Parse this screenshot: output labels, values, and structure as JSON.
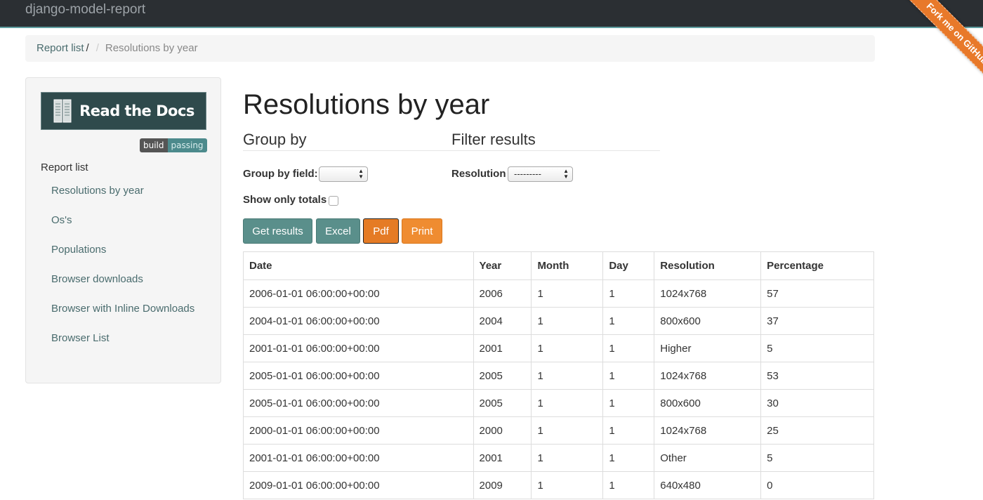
{
  "navbar": {
    "brand": "django-model-report"
  },
  "ribbon": {
    "label": "Fork me on GitHub"
  },
  "breadcrumb": {
    "items": [
      "Report list",
      "Resolutions by year"
    ],
    "slash": "/",
    "divider": "/"
  },
  "sidebar": {
    "rtd_label": "Read the Docs",
    "badge": {
      "left": "build",
      "right": "passing"
    },
    "header": "Report list",
    "items": [
      "Resolutions by year",
      "Os's",
      "Populations",
      "Browser downloads",
      "Browser with Inline Downloads",
      "Browser List"
    ]
  },
  "main": {
    "title": "Resolutions by year",
    "group_by_heading": "Group by",
    "filter_heading": "Filter results",
    "group_by_field_label": "Group by field:",
    "group_by_field_value": "",
    "resolution_label": "Resolution",
    "resolution_value": "---------",
    "show_totals_label": "Show only totals",
    "show_totals_checked": false,
    "buttons": {
      "get_results": "Get results",
      "excel": "Excel",
      "pdf": "Pdf",
      "print": "Print"
    }
  },
  "table": {
    "columns": [
      "Date",
      "Year",
      "Month",
      "Day",
      "Resolution",
      "Percentage"
    ],
    "rows": [
      [
        "2006-01-01 06:00:00+00:00",
        "2006",
        "1",
        "1",
        "1024x768",
        "57"
      ],
      [
        "2004-01-01 06:00:00+00:00",
        "2004",
        "1",
        "1",
        "800x600",
        "37"
      ],
      [
        "2001-01-01 06:00:00+00:00",
        "2001",
        "1",
        "1",
        "Higher",
        "5"
      ],
      [
        "2005-01-01 06:00:00+00:00",
        "2005",
        "1",
        "1",
        "1024x768",
        "53"
      ],
      [
        "2005-01-01 06:00:00+00:00",
        "2005",
        "1",
        "1",
        "800x600",
        "30"
      ],
      [
        "2000-01-01 06:00:00+00:00",
        "2000",
        "1",
        "1",
        "1024x768",
        "25"
      ],
      [
        "2001-01-01 06:00:00+00:00",
        "2001",
        "1",
        "1",
        "Other",
        "5"
      ],
      [
        "2009-01-01 06:00:00+00:00",
        "2009",
        "1",
        "1",
        "640x480",
        "0"
      ]
    ]
  },
  "colors": {
    "navbar": "#2b2f33",
    "accent_teal": "#5a8f8b",
    "accent_orange": "#ef8c31",
    "link": "#4a6c6e"
  },
  "icons": {
    "rtd": "book-icon",
    "select": "select-arrows-icon"
  }
}
